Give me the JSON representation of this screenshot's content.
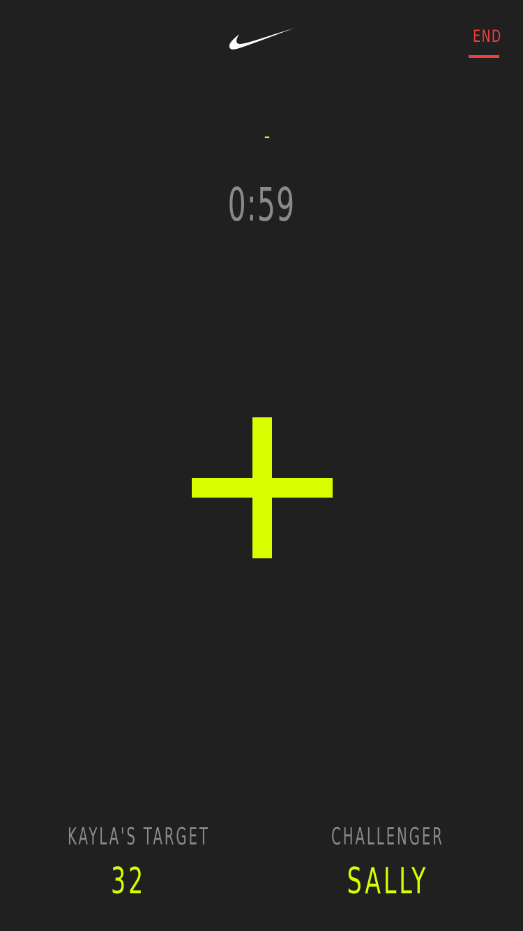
{
  "header": {
    "logo": "nike-swoosh",
    "end_label": "END"
  },
  "timer": {
    "indicator": "-",
    "time": "0:59"
  },
  "main": {
    "add_icon": "plus"
  },
  "stats": {
    "target_label": "KAYLA'S TARGET",
    "target_value": "32",
    "challenger_label": "CHALLENGER",
    "challenger_value": "SALLY"
  },
  "colors": {
    "background": "#202020",
    "accent": "#d7ff00",
    "danger": "#f23d3d",
    "muted": "#8a8a8a",
    "logo": "#ffffff"
  }
}
